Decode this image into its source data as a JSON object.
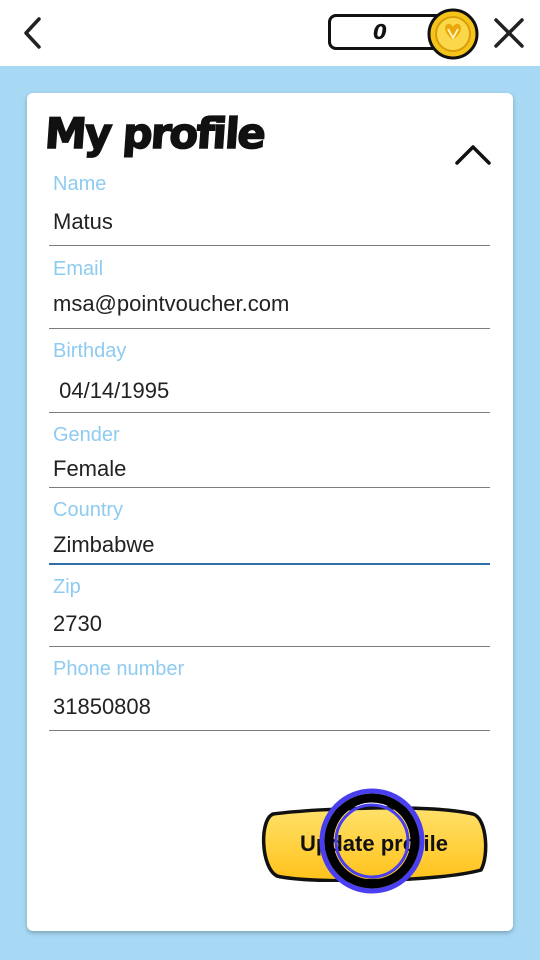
{
  "header": {
    "back_icon": "chevron-left-icon",
    "coin_count": "0",
    "coin_icon": "gold-coin-icon",
    "close_icon": "close-icon"
  },
  "profile": {
    "title": "My profile",
    "collapse_icon": "chevron-up-icon",
    "fields": {
      "name": {
        "label": "Name",
        "value": "Matus"
      },
      "email": {
        "label": "Email",
        "value": "msa@pointvoucher.com"
      },
      "birthday": {
        "label": "Birthday",
        "value": " 04/14/1995"
      },
      "gender": {
        "label": "Gender",
        "value": "Female"
      },
      "country": {
        "label": "Country",
        "value": "Zimbabwe"
      },
      "zip": {
        "label": "Zip",
        "value": "2730"
      },
      "phone": {
        "label": "Phone number",
        "value": "31850808"
      }
    },
    "update_button": "Update profile"
  },
  "colors": {
    "background": "#a7d8f4",
    "label": "#8ecbf0",
    "active_underline": "#2f6fa8",
    "button_yellow": "#ffd43b",
    "coin_gold": "#f6c31a",
    "tap_ring": "#4a3ff0"
  }
}
